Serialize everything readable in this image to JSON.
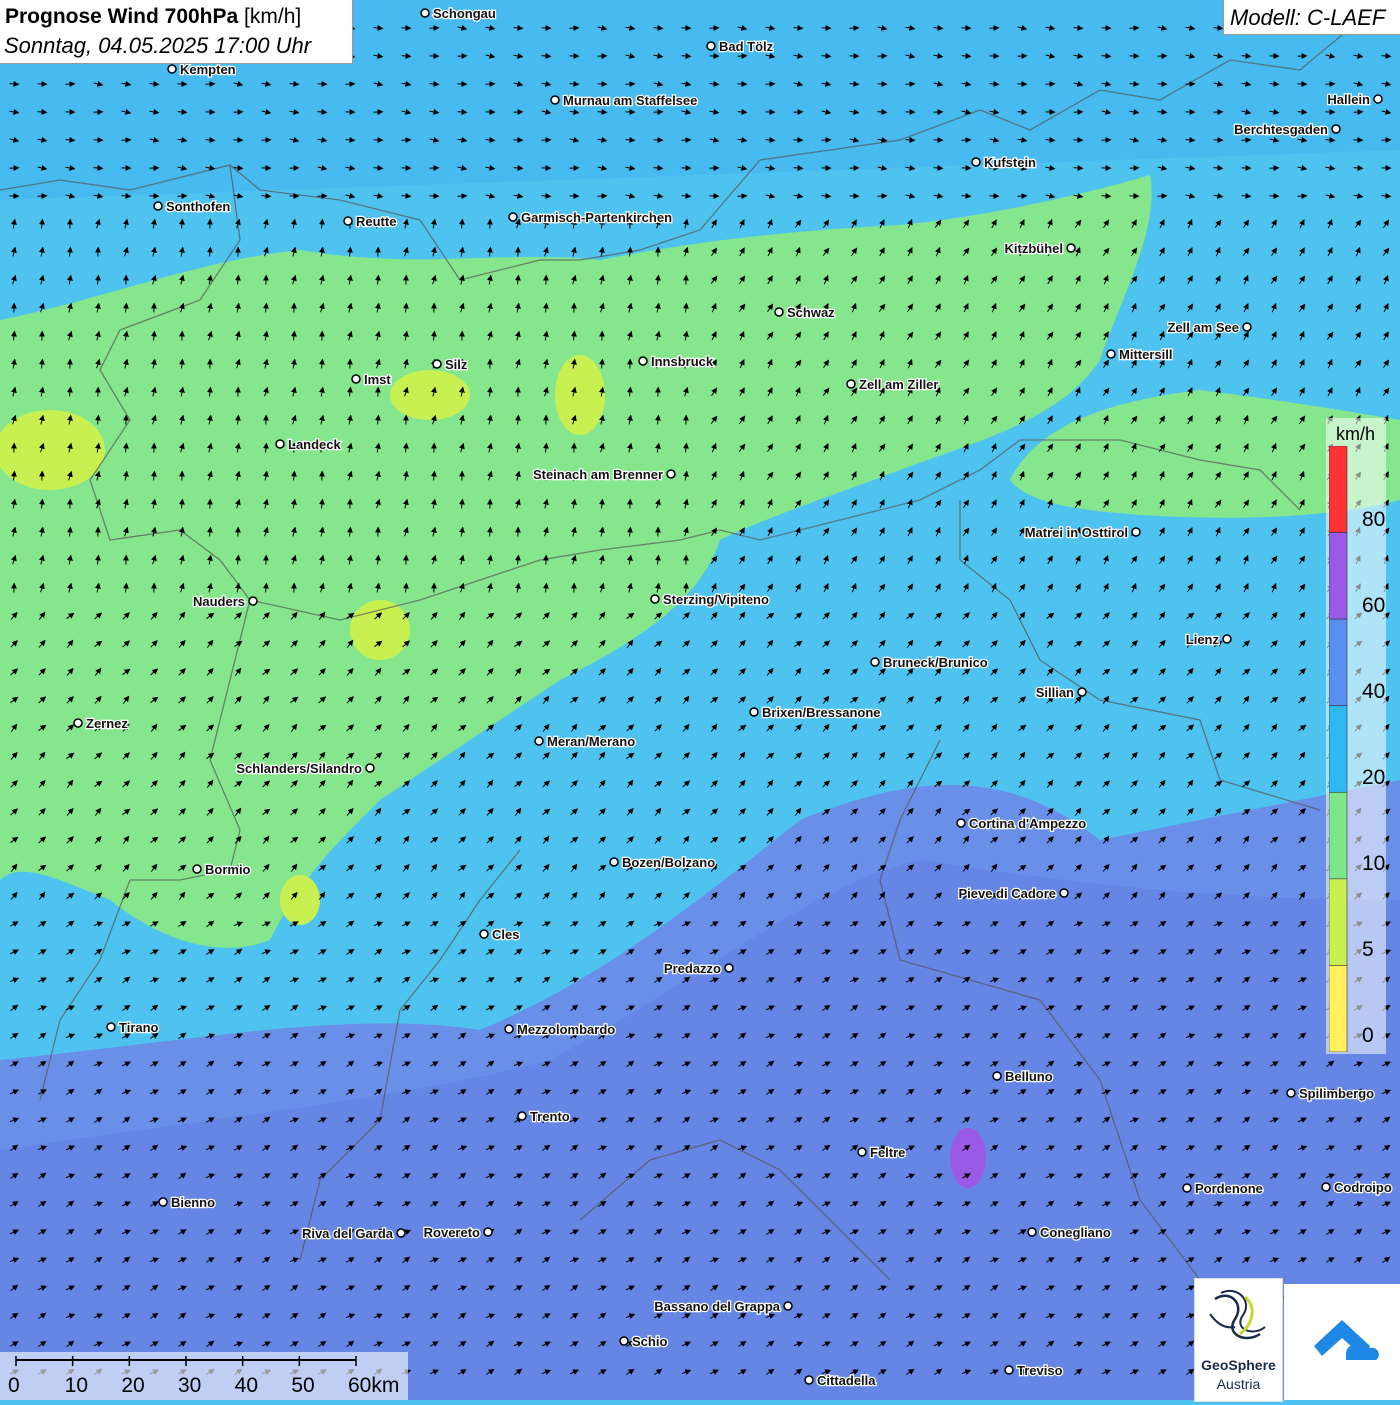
{
  "title": {
    "main_bold": "Prognose Wind 700hPa",
    "unit": "[km/h]",
    "datetime": "Sonntag, 04.05.2025 17:00 Uhr"
  },
  "model": "Modell: C-LAEF",
  "legend": {
    "unit": "km/h",
    "ticks": [
      "80",
      "60",
      "40",
      "20",
      "10",
      "5",
      "0"
    ],
    "colors": [
      "#ff3333",
      "#9a5ae6",
      "#5a8ff0",
      "#2fb8f2",
      "#7ee68a",
      "#c8f050",
      "#fff060"
    ]
  },
  "scalebar": {
    "labels": [
      "0",
      "10",
      "20",
      "30",
      "40",
      "50",
      "60km"
    ]
  },
  "branding": {
    "name": "GeoSphere",
    "sub": "Austria"
  },
  "cities": [
    {
      "name": "Schongau"
    },
    {
      "name": "Bad Tölz"
    },
    {
      "name": "Kempten"
    },
    {
      "name": "Murnau am Staffelsee"
    },
    {
      "name": "Hallein"
    },
    {
      "name": "Berchtesgaden"
    },
    {
      "name": "Kufstein"
    },
    {
      "name": "Sonthofen"
    },
    {
      "name": "Reutte"
    },
    {
      "name": "Garmisch-Partenkirchen"
    },
    {
      "name": "Kitzbühel"
    },
    {
      "name": "Schwaz"
    },
    {
      "name": "Zell am See"
    },
    {
      "name": "Mittersill"
    },
    {
      "name": "Silz"
    },
    {
      "name": "Innsbruck"
    },
    {
      "name": "Imst"
    },
    {
      "name": "Zell am Ziller"
    },
    {
      "name": "Landeck"
    },
    {
      "name": "Steinach am Brenner"
    },
    {
      "name": "Matrei in Osttirol"
    },
    {
      "name": "Nauders"
    },
    {
      "name": "Sterzing/Vipiteno"
    },
    {
      "name": "Lienz"
    },
    {
      "name": "Bruneck/Brunico"
    },
    {
      "name": "Sillian"
    },
    {
      "name": "Zernez"
    },
    {
      "name": "Brixen/Bressanone"
    },
    {
      "name": "Meran/Merano"
    },
    {
      "name": "Schlanders/Silandro"
    },
    {
      "name": "Cortina d'Ampezzo"
    },
    {
      "name": "Bozen/Bolzano"
    },
    {
      "name": "Bormio"
    },
    {
      "name": "Pieve di Cadore"
    },
    {
      "name": "Cles"
    },
    {
      "name": "Predazzo"
    },
    {
      "name": "Tirano"
    },
    {
      "name": "Mezzolombardo"
    },
    {
      "name": "Belluno"
    },
    {
      "name": "Spilimbergo"
    },
    {
      "name": "Trento"
    },
    {
      "name": "Feltre"
    },
    {
      "name": "Pordenone"
    },
    {
      "name": "Codroipo"
    },
    {
      "name": "Bienno"
    },
    {
      "name": "Riva del Garda"
    },
    {
      "name": "Rovereto"
    },
    {
      "name": "Conegliano"
    },
    {
      "name": "Bassano del Grappa"
    },
    {
      "name": "Schio"
    },
    {
      "name": "Treviso"
    },
    {
      "name": "Cittadella"
    }
  ]
}
